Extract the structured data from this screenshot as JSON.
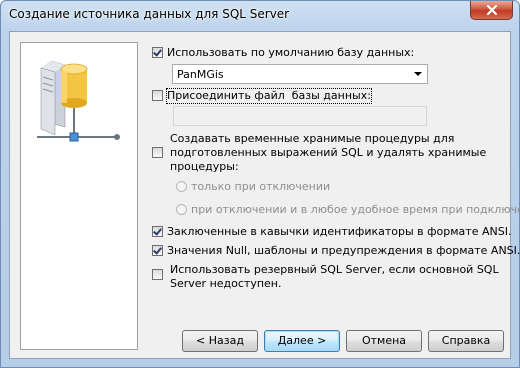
{
  "window": {
    "title": "Создание источника данных для SQL Server"
  },
  "options": {
    "use_default_db": {
      "label": "Использовать по умолчанию базу данных:",
      "checked": true
    },
    "database_value": "PanMGis",
    "attach_file": {
      "label": "Присоединить файл  базы данных:",
      "checked": false
    },
    "attach_file_value": "",
    "create_temp_procs": {
      "label": "Создавать временные хранимые процедуры для\nподготовленных выражений SQL и удалять хранимые\nпроцедуры:",
      "checked": false
    },
    "radio_on_disconnect": {
      "label": "только при отключении"
    },
    "radio_on_disconnect_and_anytime": {
      "label": "при отключении и в любое удобное время при подключении"
    },
    "quoted_identifiers": {
      "label": "Заключенные в кавычки идентификаторы в формате ANSI.",
      "checked": true
    },
    "ansi_nulls": {
      "label": "Значения Null, шаблоны и предупреждения в формате ANSI.",
      "checked": true
    },
    "failover_server": {
      "label": "Использовать резервный SQL Server, если основной SQL\nServer недоступен.",
      "checked": false
    }
  },
  "buttons": {
    "back": "< Назад",
    "next": "Далее >",
    "cancel": "Отмена",
    "help": "Справка"
  },
  "icons": {
    "illustration": "database-server-icon",
    "close": "close-icon"
  }
}
